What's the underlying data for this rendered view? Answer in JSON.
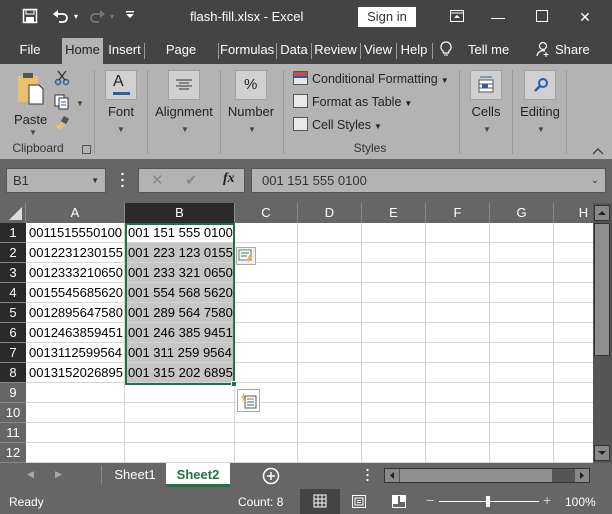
{
  "titlebar": {
    "title": "flash-fill.xlsx  -  Excel",
    "sign_in": "Sign in",
    "icons": [
      "save-icon",
      "undo-icon",
      "redo-icon",
      "customize-qat-icon",
      "ribbon-display-icon",
      "minimize-icon",
      "maximize-icon",
      "close-icon"
    ]
  },
  "tabs": [
    {
      "label": "File"
    },
    {
      "label": "Home",
      "active": true
    },
    {
      "label": "Insert"
    },
    {
      "label": "Page Layout"
    },
    {
      "label": "Formulas"
    },
    {
      "label": "Data"
    },
    {
      "label": "Review"
    },
    {
      "label": "View"
    },
    {
      "label": "Help"
    },
    {
      "label": "Tell me"
    },
    {
      "label": "Share"
    }
  ],
  "ribbon": {
    "clipboard": {
      "paste": "Paste",
      "group": "Clipboard"
    },
    "font": "Font",
    "alignment": "Alignment",
    "number": "Number",
    "number_glyph": "%",
    "styles": {
      "conditional": "Conditional Formatting",
      "format_table": "Format as Table",
      "cell_styles": "Cell Styles",
      "group": "Styles"
    },
    "cells": "Cells",
    "editing": "Editing"
  },
  "formula_bar": {
    "name_box": "B1",
    "fx": "fx",
    "formula": "001 151 555 0100"
  },
  "grid": {
    "columns": [
      "A",
      "B",
      "C",
      "D",
      "E",
      "F",
      "G",
      "H"
    ],
    "selected_column": "B",
    "rows": [
      "1",
      "2",
      "3",
      "4",
      "5",
      "6",
      "7",
      "8",
      "9",
      "10",
      "11",
      "12"
    ],
    "colA": [
      "0011515550100",
      "0012231230155",
      "0012333210650",
      "0015545685620",
      "0012895647580",
      "0012463859451",
      "0013112599564",
      "0013152026895"
    ],
    "colB": [
      "001 151 555 0100",
      "001 223 123 0155",
      "001 233 321 0650",
      "001 554 568 5620",
      "001 289 564 7580",
      "001 246 385 9451",
      "001 311 259 9564",
      "001 315 202 6895"
    ]
  },
  "sheets": [
    {
      "label": "Sheet1"
    },
    {
      "label": "Sheet2",
      "active": true
    }
  ],
  "status": {
    "ready": "Ready",
    "count": "Count: 8",
    "zoom": "100%",
    "zoom_level_percent": 100
  },
  "colors": {
    "accent": "#217346",
    "ribbon": "#b3b3b3",
    "chrome": "#444444"
  }
}
